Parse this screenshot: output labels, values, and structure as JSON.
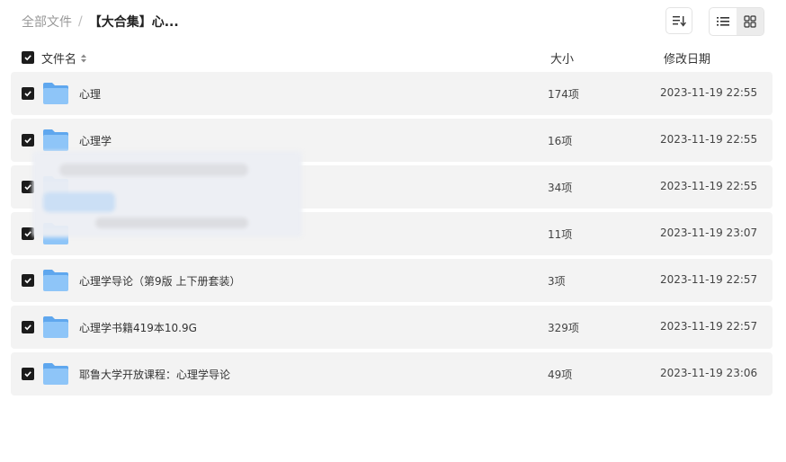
{
  "breadcrumb": {
    "root": "全部文件",
    "separator": "/",
    "current": "【大合集】心..."
  },
  "toolbar": {
    "sort_icon": "sort-icon",
    "list_view_icon": "list-view-icon",
    "grid_view_icon": "grid-view-icon"
  },
  "header": {
    "name": "文件名",
    "size": "大小",
    "date": "修改日期"
  },
  "rows": [
    {
      "name": "心理",
      "size": "174项",
      "date": "2023-11-19 22:55"
    },
    {
      "name": "心理学",
      "size": "16项",
      "date": "2023-11-19 22:55"
    },
    {
      "name": "",
      "size": "34项",
      "date": "2023-11-19 22:55"
    },
    {
      "name": "",
      "size": "11项",
      "date": "2023-11-19 23:07"
    },
    {
      "name": "心理学导论（第9版 上下册套装）",
      "size": "3项",
      "date": "2023-11-19 22:57"
    },
    {
      "name": "心理学书籍419本10.9G",
      "size": "329项",
      "date": "2023-11-19 22:57"
    },
    {
      "name": "耶鲁大学开放课程：心理学导论",
      "size": "49项",
      "date": "2023-11-19 23:06"
    }
  ],
  "colors": {
    "checkbox": "#1c1c1c",
    "row_bg": "#f3f3f3",
    "folder": "#7ab8f5"
  }
}
